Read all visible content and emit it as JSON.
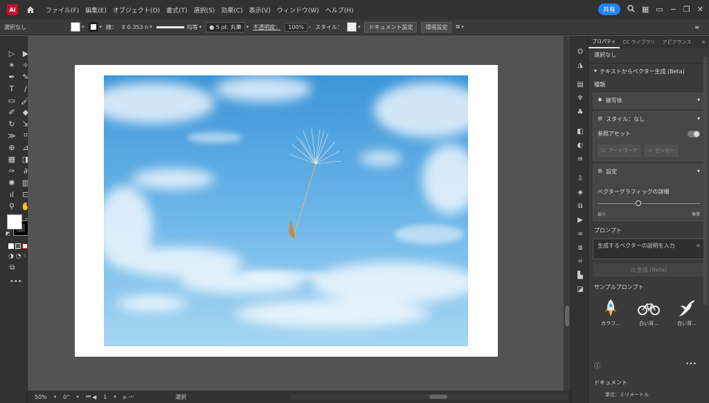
{
  "menubar": {
    "logo": "Ai",
    "menus": [
      "ファイル(F)",
      "編集(E)",
      "オブジェクト(O)",
      "書式(T)",
      "選択(S)",
      "効果(C)",
      "表示(V)",
      "ウィンドウ(W)",
      "ヘルプ(H)"
    ],
    "share": "共有"
  },
  "control": {
    "selection": "選択なし",
    "stroke_label": "線：",
    "stroke_value": "0.353 n",
    "profile_label": "均等",
    "brush_label": "5 pt. 丸筆",
    "opacity_label": "不透明度：",
    "opacity_value": "100%",
    "style_label": "スタイル：",
    "doc_setup": "ドキュメント設定",
    "preferences": "環境設定"
  },
  "status": {
    "zoom": "50%",
    "rotation": "0°",
    "artboard": "1",
    "tool": "選択"
  },
  "panel": {
    "tabs": [
      "プロパティ",
      "CC ライブラリ",
      "アピアランス"
    ],
    "selection": "選択なし",
    "section_title": "テキストからベクター生成 (Beta)",
    "type_label": "種類",
    "type_value": "被写体",
    "style_value": "スタイル：なし",
    "reference_asset": "参照アセット",
    "artwork_btn": "アートワーク",
    "picker_btn": "ピッカー",
    "settings": "設定",
    "detail_label": "ベクターグラフィックの詳細",
    "slider_min": "最小",
    "slider_max": "複雑",
    "detail_level": 0.4,
    "prompt_label": "プロンプト",
    "prompt_placeholder": "生成するベクターの説明を入力",
    "generate": "生成 (Beta)",
    "samples_label": "サンプルプロンプト",
    "samples": [
      "カラフ...",
      "白い背...",
      "白い背..."
    ],
    "document": "ドキュメント",
    "unit": "単位：ミリメートル"
  }
}
